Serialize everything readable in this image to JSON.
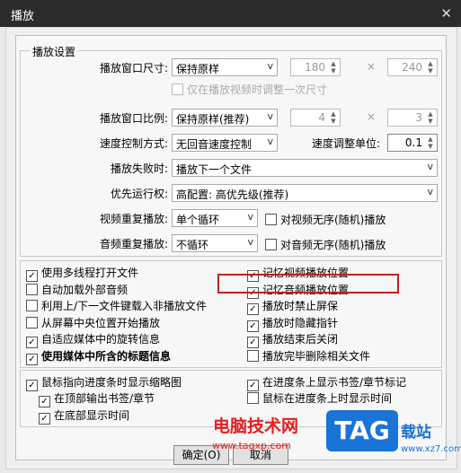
{
  "window": {
    "title": "播放",
    "close_glyph": "✕"
  },
  "settings": {
    "legend": "播放设置",
    "window_size": {
      "label": "播放窗口尺寸:",
      "value": "保持原样",
      "width": "180",
      "times": "×",
      "height": "240"
    },
    "only_once": "仅在播放视频时调整一次尺寸",
    "aspect": {
      "label": "播放窗口比例:",
      "value": "保持原样(推荐)",
      "a": "4",
      "times": "×",
      "b": "3"
    },
    "speed_mode": {
      "label": "速度控制方式:",
      "value": "无回音速度控制",
      "unit_label": "速度调整单位:",
      "unit_value": "0.1"
    },
    "on_fail": {
      "label": "播放失败时:",
      "value": "播放下一个文件"
    },
    "priority": {
      "label": "优先运行权:",
      "value": "高配置: 高优先级(推荐)"
    },
    "video_repeat": {
      "label": "视频重复播放:",
      "value": "单个循环",
      "check": "对视频无序(随机)播放"
    },
    "audio_repeat": {
      "label": "音频重复播放:",
      "value": "不循环",
      "check": "对音频无序(随机)播放"
    }
  },
  "options_left": [
    {
      "label": "使用多线程打开文件",
      "checked": true
    },
    {
      "label": "自动加载外部音频",
      "checked": false
    },
    {
      "label": "利用上/下一文件键载入非播放文件",
      "checked": false
    },
    {
      "label": "从屏幕中央位置开始播放",
      "checked": false
    },
    {
      "label": "自适应媒体中的旋转信息",
      "checked": true
    },
    {
      "label": "使用媒体中所含的标题信息",
      "checked": true
    }
  ],
  "options_right": [
    {
      "label": "记忆视频播放位置",
      "checked": true
    },
    {
      "label": "记忆音频播放位置",
      "checked": true
    },
    {
      "label": "播放时禁止屏保",
      "checked": true
    },
    {
      "label": "播放时隐藏指针",
      "checked": true
    },
    {
      "label": "播放结束后关闭",
      "checked": true
    },
    {
      "label": "播放完毕删除相关文件",
      "checked": false
    }
  ],
  "thumb": {
    "main": "鼠标指向进度条时显示缩略图",
    "sub1": "在顶部输出书签/章节",
    "sub2": "在底部显示时间",
    "right1": "在进度条上显示书签/章节标记",
    "right2": "鼠标在进度条上时显示时间"
  },
  "buttons": {
    "ok": "确定(O)",
    "cancel": "取消"
  },
  "watermark": {
    "site_name": "电脑技术网",
    "url": "www.tagxp.com",
    "logo": "TAG",
    "suffix": "载站",
    "small_url": "www.xz7.com"
  },
  "icons": {
    "check": "✓",
    "arrow": "v",
    "spin_up": "▲",
    "spin_down": "▼"
  }
}
